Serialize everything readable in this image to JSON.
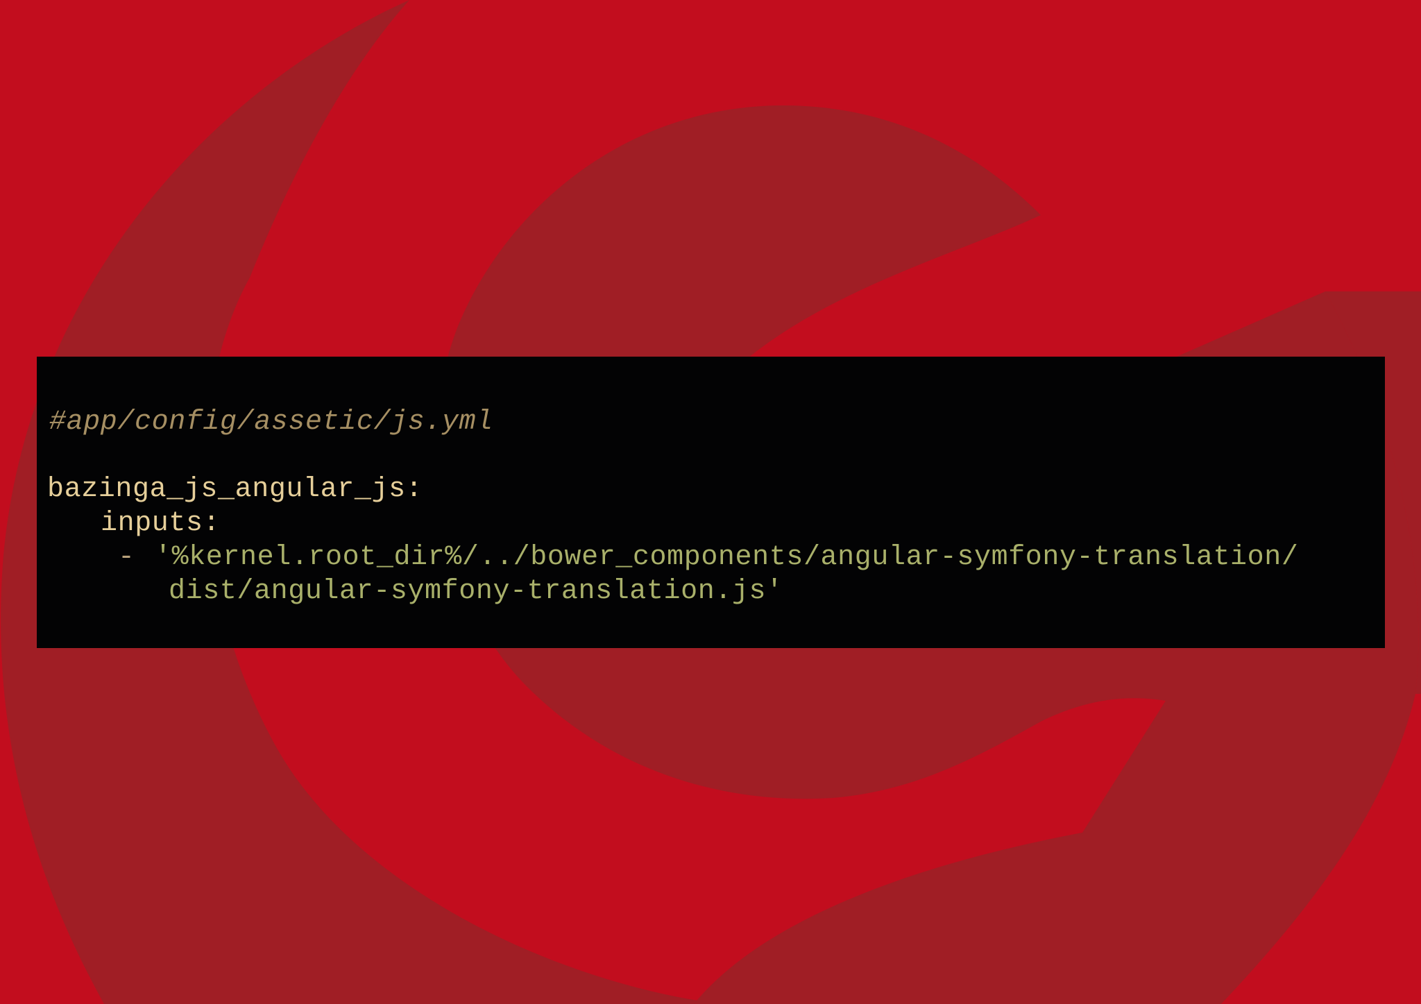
{
  "colors": {
    "background": "#c20d1e",
    "logo_shade": "#a01e25",
    "code_background": "#030304",
    "comment": "#a68f63",
    "key": "#e6cf9a",
    "string": "#a9b06a"
  },
  "code": {
    "language": "yaml",
    "comment": "#app/config/assetic/js.yml",
    "root_key": "bazinga_js_angular_js:",
    "inputs_key": "inputs:",
    "list_dash": "-",
    "path_line_1": "'%kernel.root_dir%/../bower_components/angular-symfony-translation/",
    "path_line_2": "dist/angular-symfony-translation.js'"
  }
}
